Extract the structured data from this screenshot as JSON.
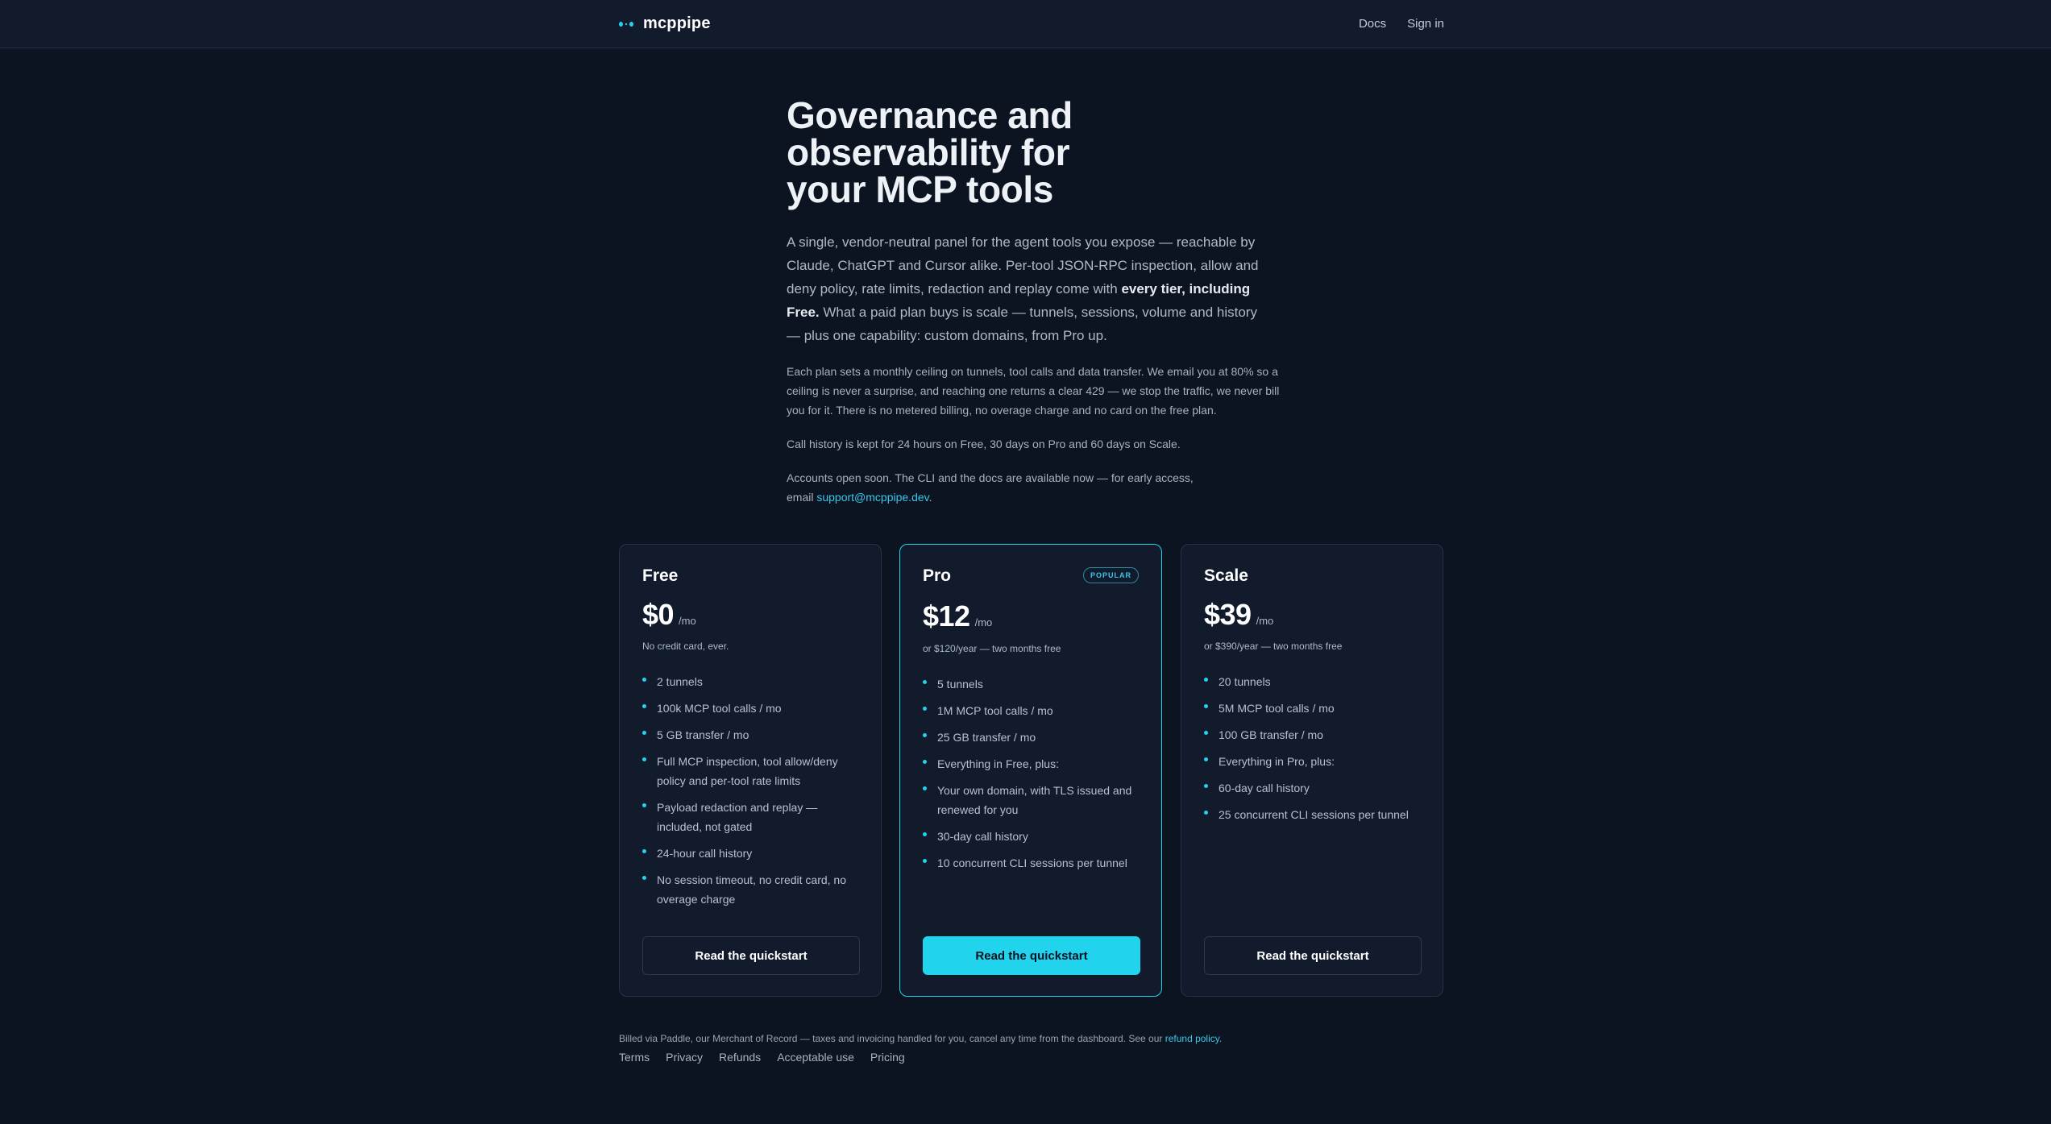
{
  "header": {
    "brand": "mcppipe",
    "nav": {
      "docs": "Docs",
      "sign_in": "Sign in"
    }
  },
  "hero": {
    "title_line1": "Governance and",
    "title_line2": "observability for",
    "title_line3": "your MCP tools",
    "lead_part1": "A single, vendor-neutral panel for the agent tools you expose — reachable by Claude, ChatGPT and Cursor alike. Per-tool JSON-RPC inspection, allow and deny policy, rate limits, redaction and replay come with ",
    "lead_bold": "every tier, including Free.",
    "lead_part2": " What a paid plan buys is scale — tunnels, sessions, volume and history — plus one capability: custom domains, from Pro up.",
    "limits_text": "Each plan sets a monthly ceiling on tunnels, tool calls and data transfer. We email you at 80% so a ceiling is never a surprise, and reaching one returns a clear 429 — we stop the traffic, we never bill you for it. There is no metered billing, no overage charge and no card on the free plan.",
    "history_text": "Call history is kept for 24 hours on Free, 30 days on Pro and 60 days on Scale.",
    "access_text": "Accounts open soon. The CLI and the docs are available now — for early access, email ",
    "access_email": "support@mcppipe.dev",
    "access_end": "."
  },
  "plans": {
    "free": {
      "name": "Free",
      "price": "$0",
      "period": "/mo",
      "note": "No credit card, ever.",
      "features": [
        "2 tunnels",
        "100k MCP tool calls / mo",
        "5 GB transfer / mo",
        "Full MCP inspection, tool allow/deny policy and per-tool rate limits",
        "Payload redaction and replay — included, not gated",
        "24-hour call history",
        "No session timeout, no credit card, no overage charge"
      ],
      "cta": "Read the quickstart"
    },
    "pro": {
      "name": "Pro",
      "badge": "POPULAR",
      "price": "$12",
      "period": "/mo",
      "note": "or $120/year — two months free",
      "features": [
        "5 tunnels",
        "1M MCP tool calls / mo",
        "25 GB transfer / mo",
        "Everything in Free, plus:",
        "Your own domain, with TLS issued and renewed for you",
        "30-day call history",
        "10 concurrent CLI sessions per tunnel"
      ],
      "cta": "Read the quickstart"
    },
    "scale": {
      "name": "Scale",
      "price": "$39",
      "period": "/mo",
      "note": "or $390/year — two months free",
      "features": [
        "20 tunnels",
        "5M MCP tool calls / mo",
        "100 GB transfer / mo",
        "Everything in Pro, plus:",
        "60-day call history",
        "25 concurrent CLI sessions per tunnel"
      ],
      "cta": "Read the quickstart"
    }
  },
  "footer": {
    "billing_text": "Billed via Paddle, our Merchant of Record — taxes and invoicing handled for you, cancel any time from the dashboard. See our ",
    "refund_link": "refund policy",
    "billing_end": ".",
    "links": {
      "terms": "Terms",
      "privacy": "Privacy",
      "refunds": "Refunds",
      "acceptable_use": "Acceptable use",
      "pricing": "Pricing"
    }
  },
  "colors": {
    "accent": "#22d3ee",
    "background": "#0c1422",
    "card": "#111b2b"
  }
}
